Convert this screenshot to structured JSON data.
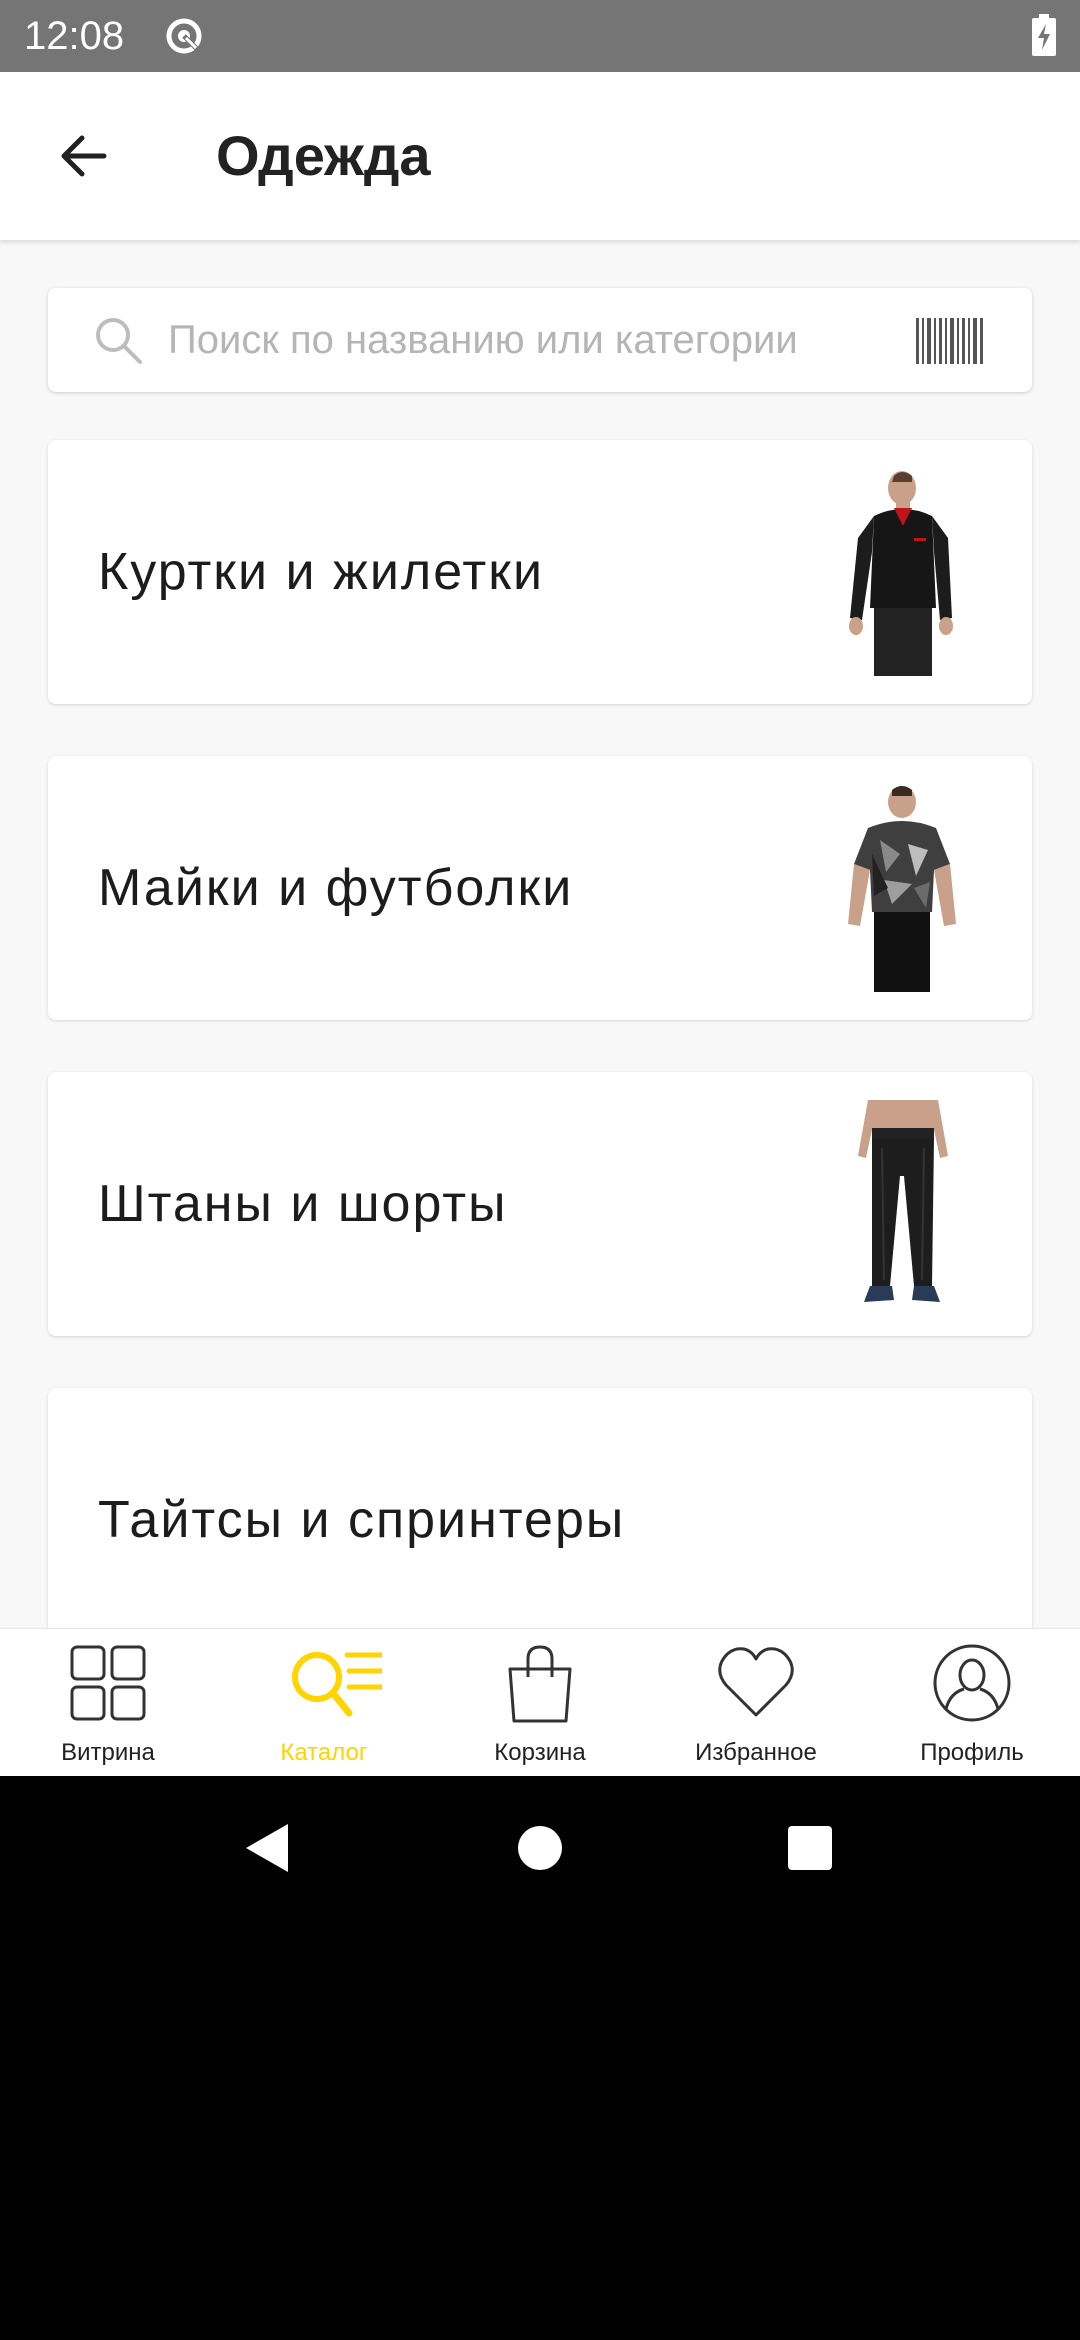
{
  "status_bar": {
    "time": "12:08",
    "icons": [
      "sync-icon",
      "battery-charging-icon"
    ]
  },
  "app_bar": {
    "title": "Одежда",
    "back_icon": "arrow-left-icon"
  },
  "search": {
    "placeholder": "Поиск по названию или категории",
    "value": "",
    "icons": [
      "search-icon",
      "barcode-icon"
    ]
  },
  "categories": [
    {
      "label": "Куртки и жилетки",
      "image": "jacket-image"
    },
    {
      "label": "Майки и футболки",
      "image": "tshirt-image"
    },
    {
      "label": "Штаны и шорты",
      "image": "pants-image"
    },
    {
      "label": "Тайтсы и спринтеры",
      "image": ""
    }
  ],
  "bottom_nav": {
    "items": [
      {
        "label": "Витрина",
        "icon": "grid-icon",
        "active": false
      },
      {
        "label": "Каталог",
        "icon": "catalog-search-icon",
        "active": true
      },
      {
        "label": "Корзина",
        "icon": "shopping-bag-icon",
        "active": false
      },
      {
        "label": "Избранное",
        "icon": "heart-icon",
        "active": false
      },
      {
        "label": "Профиль",
        "icon": "profile-icon",
        "active": false
      }
    ]
  },
  "system_nav": {
    "icons": [
      "back-triangle-icon",
      "home-circle-icon",
      "recents-square-icon"
    ]
  },
  "colors": {
    "accent": "#ffd400",
    "status_bar": "#757575",
    "background": "#f8f8f8",
    "text_primary": "#1c1c1c",
    "placeholder": "#b5b5b5"
  }
}
